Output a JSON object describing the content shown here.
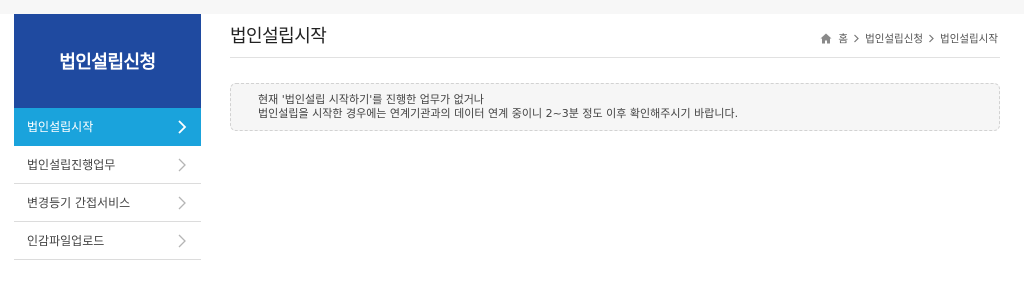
{
  "sidebar": {
    "title": "법인설립신청",
    "items": [
      {
        "label": "법인설립시작"
      },
      {
        "label": "법인설립진행업무"
      },
      {
        "label": "변경등기 간접서비스"
      },
      {
        "label": "인감파일업로드"
      }
    ]
  },
  "main": {
    "title": "법인설립시작",
    "breadcrumb": [
      "홈",
      "법인설립신청",
      "법인설립시작"
    ],
    "notice": {
      "line1": "현재 '법인설립 시작하기'를 진행한 업무가 없거나",
      "line2": "법인설립을 시작한 경우에는 연계기관과의 데이터 연계 중이니 2~3분 정도 이후 확인해주시기 바랍니다."
    }
  },
  "colors": {
    "sidebar_header": "#1f4aa0",
    "active_item": "#1aa3dc"
  },
  "icons": [
    "home-icon",
    "chevron-right-icon"
  ]
}
